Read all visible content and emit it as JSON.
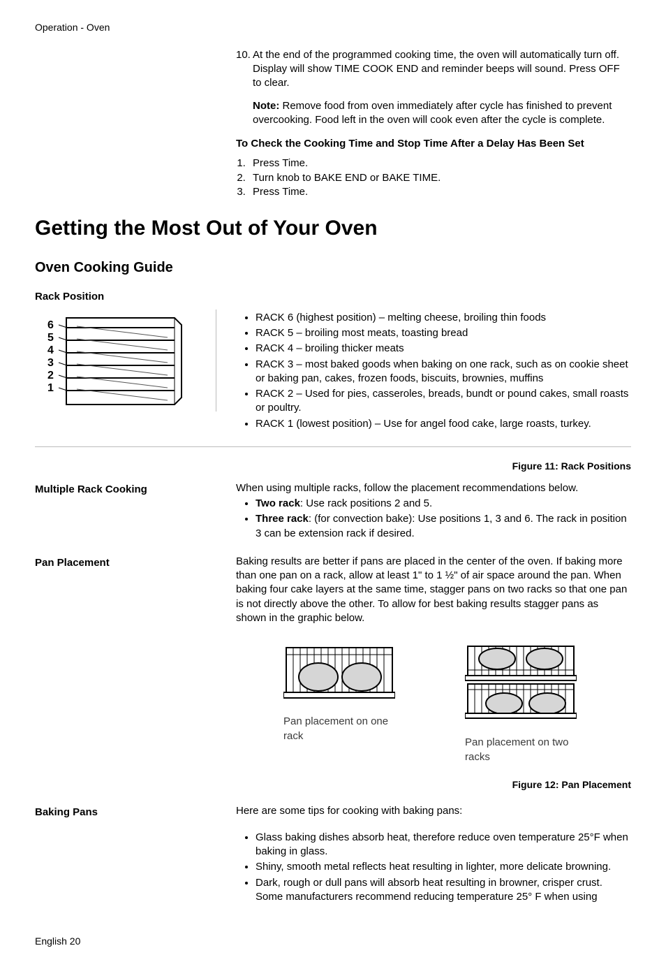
{
  "running_head": "Operation - Oven",
  "step10": {
    "num": "10.",
    "text": "At the end of the programmed cooking time, the oven will automatically turn off. Display will show TIME COOK END and reminder beeps will sound. Press OFF to clear."
  },
  "note": {
    "label": "Note:",
    "text": " Remove food from oven immediately after cycle has finished to prevent overcooking. Food left in the oven will cook even after the cycle is complete."
  },
  "check_heading": "To Check the Cooking Time and Stop Time After a Delay Has Been Set",
  "check_steps": [
    "Press Time.",
    "Turn knob to BAKE END or BAKE TIME.",
    "Press Time."
  ],
  "h1": "Getting the Most Out of Your Oven",
  "h2": "Oven Cooking Guide",
  "rack_heading": "Rack Position",
  "rack_numbers": [
    "6",
    "5",
    "4",
    "3",
    "2",
    "1"
  ],
  "rack_items": [
    "RACK 6 (highest position) –  melting cheese, broiling thin foods",
    "RACK 5 –  broiling most meats, toasting bread",
    "RACK 4 –  broiling thicker meats",
    "RACK 3 –  most baked goods when baking on one rack, such as on cookie sheet or baking pan, cakes, frozen foods, biscuits, brownies, muffins",
    "RACK 2 – Used for pies, casseroles, breads, bundt or pound cakes, small roasts or poultry.",
    "RACK 1 (lowest position) – Use for angel food cake, large roasts, turkey."
  ],
  "fig11": "Figure 11: Rack Positions",
  "multi_heading": "Multiple Rack Cooking",
  "multi_intro": "When using multiple racks, follow the placement recommendations below.",
  "multi_items": [
    {
      "b": "Two rack",
      "t": ": Use rack positions 2 and 5."
    },
    {
      "b": "Three rack",
      "t": ": (for convection bake): Use positions 1, 3 and 6. The rack in position 3 can be extension rack if desired."
    }
  ],
  "pan_heading": "Pan Placement",
  "pan_text": "Baking results are better if pans are placed in the center of the oven. If baking more than one pan on a rack, allow at least 1\" to 1 ½\" of air space around the pan. When baking four cake layers at the same time, stagger pans on two racks so that one pan is not directly above the other. To allow for best baking results stagger pans as shown in the graphic below.",
  "pan_fig1_label": "Pan placement on one rack",
  "pan_fig2_label": "Pan placement on two racks",
  "fig12": "Figure 12: Pan Placement",
  "baking_heading": "Baking Pans",
  "baking_intro": "Here are some tips for cooking with baking pans:",
  "baking_items": [
    "Glass baking dishes absorb heat, therefore reduce oven temperature 25°F when baking in glass.",
    "Shiny, smooth metal reflects heat resulting in lighter, more delicate browning.",
    "Dark, rough or dull pans will absorb heat resulting in browner, crisper crust. Some manufacturers recommend reducing temperature 25° F when using"
  ],
  "footer": "English 20"
}
